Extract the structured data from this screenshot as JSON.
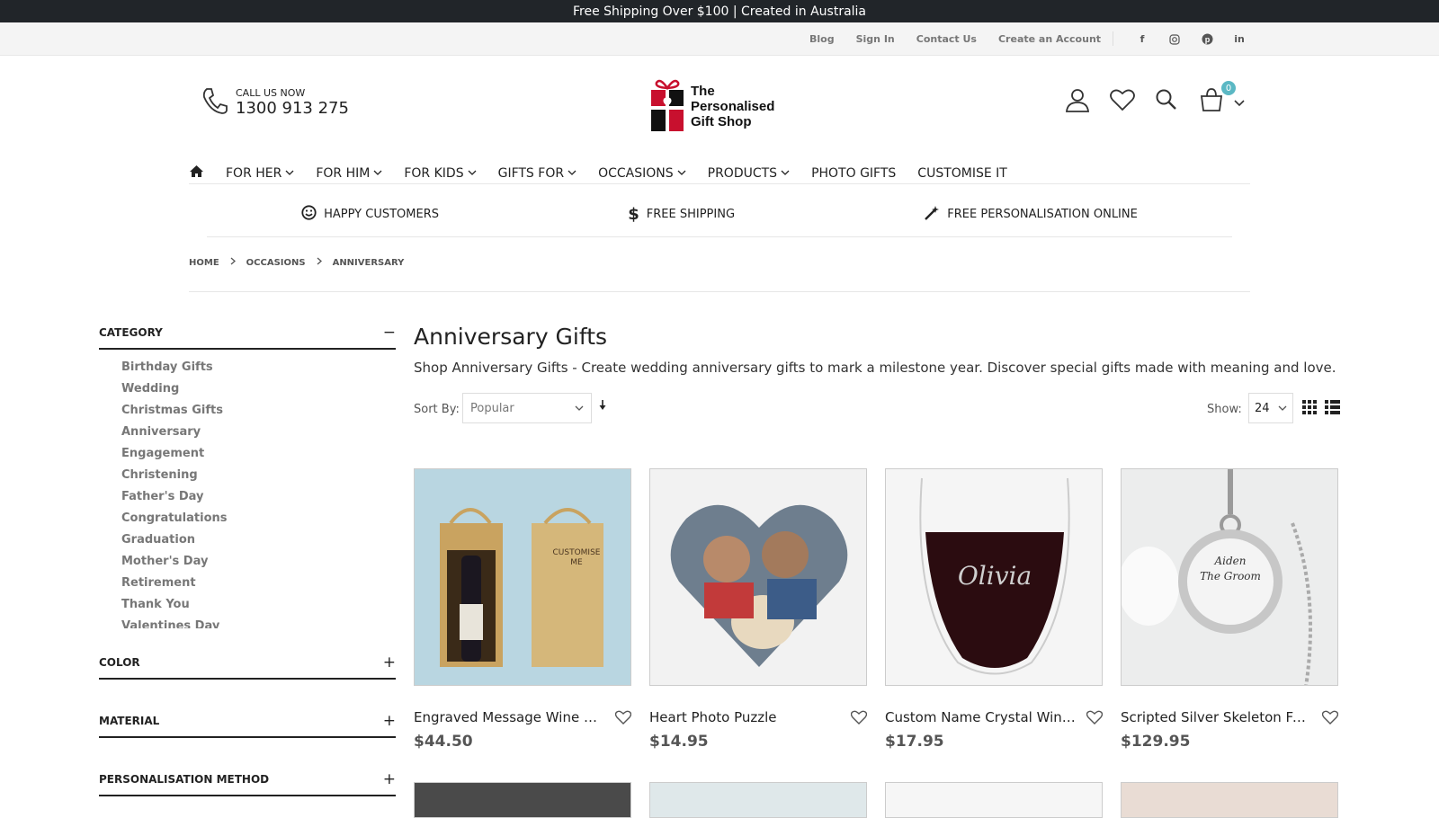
{
  "topbar": {
    "message": "Free Shipping Over $100  | Created in Australia"
  },
  "toplinks": [
    "Blog",
    "Sign In",
    "Contact Us",
    "Create an Account"
  ],
  "social_icons": [
    "facebook-icon",
    "instagram-icon",
    "pinterest-icon",
    "linkedin-icon"
  ],
  "header": {
    "call_label": "CALL US NOW",
    "phone": "1300 913 275",
    "logo_text_1": "The",
    "logo_text_2": "Personalised",
    "logo_text_3": "Gift Shop",
    "cart_count": "0"
  },
  "nav": [
    "FOR HER",
    "FOR HIM",
    "FOR KIDS",
    "GIFTS FOR",
    "OCCASIONS",
    "PRODUCTS",
    "PHOTO GIFTS",
    "CUSTOMISE IT"
  ],
  "features": [
    "HAPPY CUSTOMERS",
    "FREE SHIPPING",
    "FREE PERSONALISATION ONLINE"
  ],
  "breadcrumb": [
    "HOME",
    "OCCASIONS",
    "ANNIVERSARY"
  ],
  "sidebar": {
    "category_title": "CATEGORY",
    "category_toggle": "−",
    "categories": [
      "Birthday Gifts",
      "Wedding",
      "Christmas Gifts",
      "Anniversary",
      "Engagement",
      "Christening",
      "Father's Day",
      "Congratulations",
      "Graduation",
      "Mother's Day",
      "Retirement",
      "Thank You",
      "Valentines Day"
    ],
    "facets": [
      {
        "title": "COLOR",
        "toggle": "+"
      },
      {
        "title": "MATERIAL",
        "toggle": "+"
      },
      {
        "title": "PERSONALISATION METHOD",
        "toggle": "+"
      }
    ]
  },
  "main": {
    "title": "Anniversary Gifts",
    "description": "Shop Anniversary Gifts - Create wedding anniversary gifts to mark a milestone year. Discover special gifts made with meaning and love.",
    "sort_label": "Sort By:",
    "sort_value": "Popular",
    "show_label": "Show:",
    "show_value": "24"
  },
  "products": [
    {
      "name": "Engraved Message Wine Box",
      "price": "$44.50"
    },
    {
      "name": "Heart Photo Puzzle",
      "price": "$14.95"
    },
    {
      "name": "Custom Name Crystal Wine Glass",
      "price": "$17.95"
    },
    {
      "name": "Scripted Silver Skeleton Face Pocket Watch",
      "price": "$129.95"
    }
  ],
  "product_image_text": {
    "wine_box_label": "CUSTOMISE ME",
    "glass_name": "Olivia",
    "watch_line1": "Aiden",
    "watch_line2": "The Groom"
  },
  "colors": {
    "accent": "#5bb8c4",
    "logo_red": "#c8102e",
    "dark": "#212529"
  }
}
